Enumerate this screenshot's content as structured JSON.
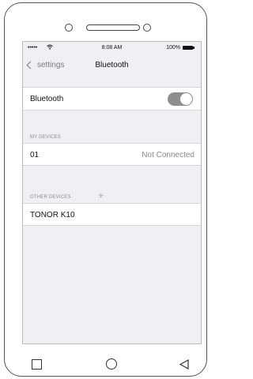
{
  "status_bar": {
    "signal": "•••••",
    "time": "8:08 AM",
    "battery": "100%"
  },
  "nav": {
    "back_label": "settings",
    "title": "Bluetooth"
  },
  "bluetooth": {
    "label": "Bluetooth",
    "enabled": true
  },
  "my_devices": {
    "header": "MY DEVICES",
    "items": [
      {
        "name": "01",
        "status": "Not Connected"
      }
    ]
  },
  "other_devices": {
    "header": "OTHER DEVICES",
    "items": [
      {
        "name": "TONOR K10"
      }
    ]
  }
}
